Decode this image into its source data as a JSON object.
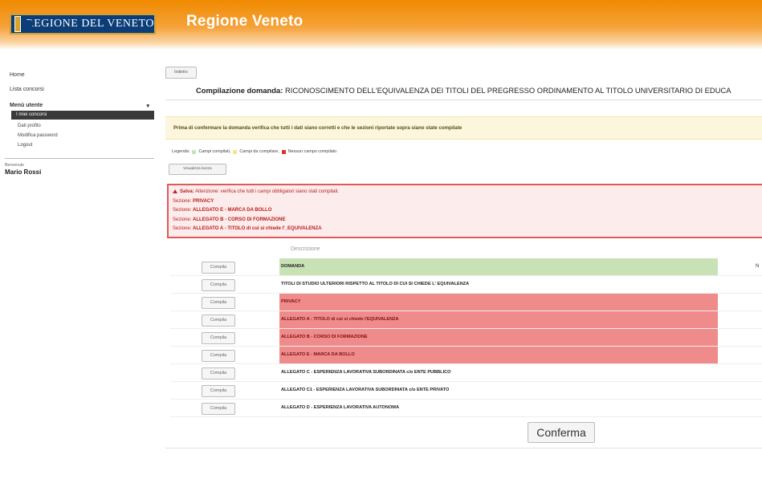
{
  "header": {
    "logo_text": "REGIONE DEL VENETO",
    "title": "Regione Veneto",
    "colors": {
      "header_orange": "#f08a00",
      "logo_blue": "#0b3d78"
    }
  },
  "sidebar": {
    "links": [
      "Home",
      "Lista concorsi"
    ],
    "menu_head": "Menù utente",
    "active_item": "I miei concorsi",
    "sub_items": [
      "Dati profilo",
      "Modifica password",
      "Logout"
    ],
    "user_label": "Benvenuto",
    "user_name": "Mario Rossi"
  },
  "main": {
    "back_label": "Indietro",
    "title_prefix": "Compilazione domanda:",
    "title_rest": " RICONOSCIMENTO DELL'EQUIVALENZA DEI TITOLI DEL PREGRESSO ORDINAMENTO AL TITOLO UNIVERSITARIO DI EDUCA",
    "warning": "Prima di confermare la domanda verifica che tutti i dati siano corretti e che le sezioni riportate sopra siano state compilate",
    "legend": {
      "label": "Legenda:",
      "items": [
        "Campi compilati,",
        "Campi da compilare,",
        "Nessun campo compilato"
      ],
      "colors": [
        "#c9e2b5",
        "#f6e58d",
        "#e03030"
      ]
    },
    "preview_button": "Visualizza bozza",
    "errors": {
      "header_bold": "Salva:",
      "header_text": " Attenzione: verifica che tutti i campi obbligatori siano stati compilati.",
      "sections": [
        {
          "label": "Sezione:",
          "name": "PRIVACY"
        },
        {
          "label": "Sezione:",
          "name": "ALLEGATO E - MARCA DA BOLLO"
        },
        {
          "label": "Sezione:",
          "name": "ALLEGATO B - CORSO DI FORMAZIONE"
        },
        {
          "label": "Sezione:",
          "name": "ALLEGATO A - TITOLO di cui si chiede l'_EQUIVALENZA"
        }
      ]
    },
    "column_header": "Descrizione",
    "row_button_label": "Compila",
    "rows": [
      {
        "description": "DOMANDA",
        "status": "green",
        "trail": "N"
      },
      {
        "description": "TITOLI DI STUDIO ULTERIORI RISPETTO AL TITOLO DI CUI SI CHIEDE L' EQUIVALENZA",
        "status": "none"
      },
      {
        "description": "PRIVACY",
        "status": "red"
      },
      {
        "description": "ALLEGATO A - TITOLO di cui si chiede l'EQUIVALENZA",
        "status": "red"
      },
      {
        "description": "ALLEGATO B - CORSO DI FORMAZIONE",
        "status": "red"
      },
      {
        "description": "ALLEGATO E - MARCA DA BOLLO",
        "status": "red"
      },
      {
        "description": "ALLEGATO C - ESPERIENZA LAVORATIVA SUBORDINATA c/o ENTE PUBBLICO",
        "status": "none"
      },
      {
        "description": "ALLEGATO C1 - ESPERIENZA LAVORATIVA SUBORDINATA c/o ENTE PRIVATO",
        "status": "none"
      },
      {
        "description": "ALLEGATO D - ESPERIENZA LAVORATIVA AUTONOMA",
        "status": "none"
      }
    ],
    "confirm_label": "Conferma"
  }
}
